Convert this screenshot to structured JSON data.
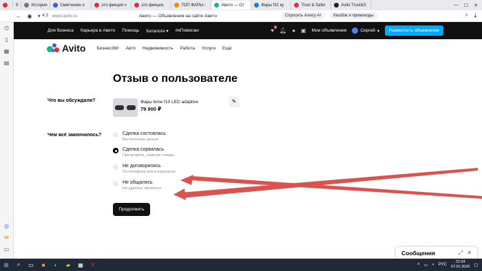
{
  "browser": {
    "tabs": [
      {
        "label": "",
        "color": "#e03131"
      },
      {
        "label": "9",
        "color": "#555555"
      },
      {
        "label": "История",
        "color": "#555555"
      },
      {
        "label": "Смягчение о",
        "color": "#3b5bdb"
      },
      {
        "label": "это фикция ч",
        "color": "#e03131"
      },
      {
        "label": "это фикция,",
        "color": "#e03131"
      },
      {
        "label": "ТОП ФАРЫ -",
        "color": "#f08c00"
      },
      {
        "label": "Авито — От",
        "color": "#12b886",
        "active": true
      },
      {
        "label": "Фары f32 ку",
        "color": "#1c7ed6"
      },
      {
        "label": "Trust & Safet",
        "color": "#e03131"
      },
      {
        "label": "Avito Trust&S",
        "color": "#222222"
      }
    ],
    "rating": "4,3",
    "url": "www.avito.ru",
    "page_title": "Авито — Объявления на сайте Авито",
    "ai_button": "Спросить Алису AI",
    "cashback": "Кешбэк и промокоды"
  },
  "avito_nav": {
    "links": [
      "Для бизнеса",
      "Карьера в Авито",
      "Помощь",
      "Каталоги",
      "#яПомогаю"
    ],
    "favorites_badge": "2",
    "my_ads": "Мои объявления",
    "user": "Сергей",
    "post_button": "Разместить объявление"
  },
  "subheader": {
    "logo": "Avito",
    "categories": [
      "Бизнес360",
      "Авто",
      "Недвижимость",
      "Работа",
      "Услуги",
      "Ещё"
    ]
  },
  "page": {
    "title": "Отзыв о пользователе",
    "question_item": "Что вы обсуждали?",
    "item_title": "Фары bmw f10 LED adaptive",
    "item_price": "79 900 ₽",
    "question_outcome": "Чем всё закончилось?",
    "options": [
      {
        "title": "Сделка состоялась",
        "subtitle": "Вы получили деньги",
        "checked": false
      },
      {
        "title": "Сделка сорвалась",
        "subtitle": "При встрече, осмотре товара",
        "checked": true
      },
      {
        "title": "Не договорились",
        "subtitle": "По телефону или в переписке",
        "checked": false
      },
      {
        "title": "Не общались",
        "subtitle": "Не удалось связаться",
        "checked": false
      }
    ],
    "continue_button": "Продолжить",
    "messages_title": "Сообщения"
  },
  "annotation": {
    "arrow_color": "#d9534f"
  },
  "taskbar": {
    "lang": "РУС",
    "time": "22:34",
    "date": "07.01.2026"
  }
}
